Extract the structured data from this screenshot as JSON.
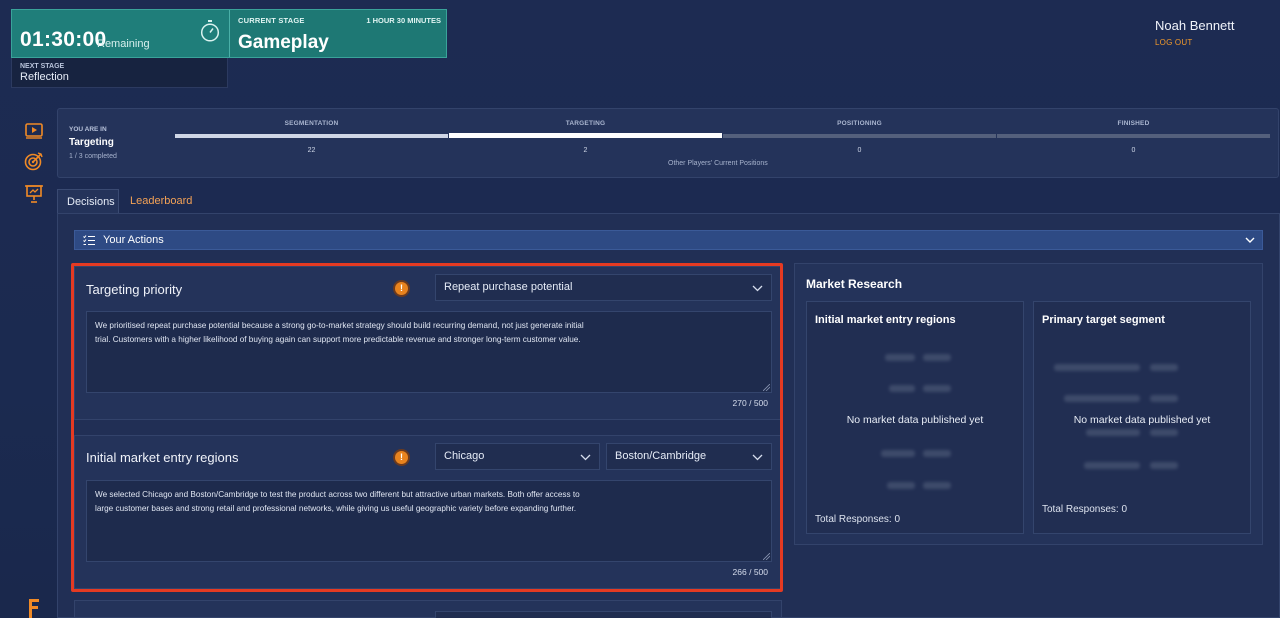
{
  "timer": {
    "time": "01:30:00",
    "remaining_label": "Remaining",
    "current_stage_label": "CURRENT STAGE",
    "duration": "1 HOUR 30 MINUTES",
    "stage_name": "Gameplay",
    "next_stage_label": "NEXT STAGE",
    "next_stage_name": "Reflection"
  },
  "user": {
    "name": "Noah Bennett",
    "logout": "LOG OUT"
  },
  "rail": {
    "icons": [
      "video-play-icon",
      "target-icon",
      "presentation-icon"
    ],
    "brand": "brand-logo-icon"
  },
  "progress": {
    "you_are_in_label": "YOU ARE IN",
    "current": "Targeting",
    "completed": "1 / 3 completed",
    "steps": [
      {
        "label": "SEGMENTATION",
        "count": "22",
        "state": "done"
      },
      {
        "label": "TARGETING",
        "count": "2",
        "state": "active"
      },
      {
        "label": "POSITIONING",
        "count": "0",
        "state": "pending"
      },
      {
        "label": "FINISHED",
        "count": "0",
        "state": "pending"
      }
    ],
    "other_players_label": "Other Players' Current Positions"
  },
  "tabs": {
    "decisions": "Decisions",
    "leaderboard": "Leaderboard"
  },
  "actions": {
    "title": "Your Actions"
  },
  "decisions": [
    {
      "title": "Targeting priority",
      "selects": [
        "Repeat purchase potential"
      ],
      "text_line1": "We prioritised repeat purchase potential because a strong go-to-market strategy should build recurring demand, not just generate initial",
      "text_line2": "trial. Customers with a higher likelihood of buying again can support more predictable revenue and stronger long-term customer value.",
      "counter": "270 / 500"
    },
    {
      "title": "Initial market entry regions",
      "selects": [
        "Chicago",
        "Boston/Cambridge"
      ],
      "text_line1": "We selected Chicago and Boston/Cambridge to test the product across two different but attractive urban markets. Both offer access to",
      "text_line2": "large customer bases and strong retail and professional networks, while giving us useful geographic variety before expanding further.",
      "counter": "266 / 500"
    }
  ],
  "market_research": {
    "title": "Market Research",
    "cards": [
      {
        "title": "Initial market entry regions",
        "empty": "No market data published yet",
        "total": "Total Responses: 0"
      },
      {
        "title": "Primary target segment",
        "empty": "No market data published yet",
        "total": "Total Responses: 0"
      }
    ]
  },
  "colors": {
    "accent_teal": "#1f7e7a",
    "accent_orange": "#f39a2b",
    "highlight_red": "#e53a22",
    "background": "#1d2b52"
  }
}
